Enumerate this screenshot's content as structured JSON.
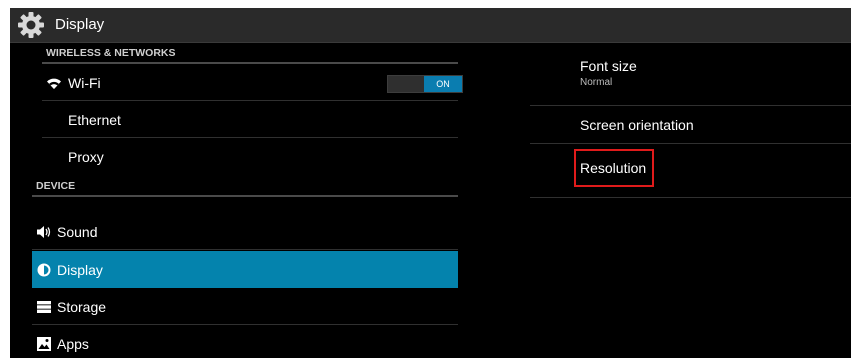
{
  "actionbar": {
    "title": "Display",
    "icon": "gear-icon"
  },
  "sidebar": {
    "header_wireless": "WIRELESS & NETWORKS",
    "wifi_label": "Wi-Fi",
    "wifi_toggle": "ON",
    "ethernet_label": "Ethernet",
    "proxy_label": "Proxy",
    "header_device": "DEVICE",
    "sound_label": "Sound",
    "display_label": "Display",
    "storage_label": "Storage",
    "apps_label": "Apps"
  },
  "detail": {
    "font_size_title": "Font size",
    "font_size_value": "Normal",
    "orientation_title": "Screen orientation",
    "resolution_title": "Resolution"
  },
  "colors": {
    "selected": "#0483ad",
    "highlight_box": "#e01b1b",
    "toggle_on": "#0a7db0"
  }
}
